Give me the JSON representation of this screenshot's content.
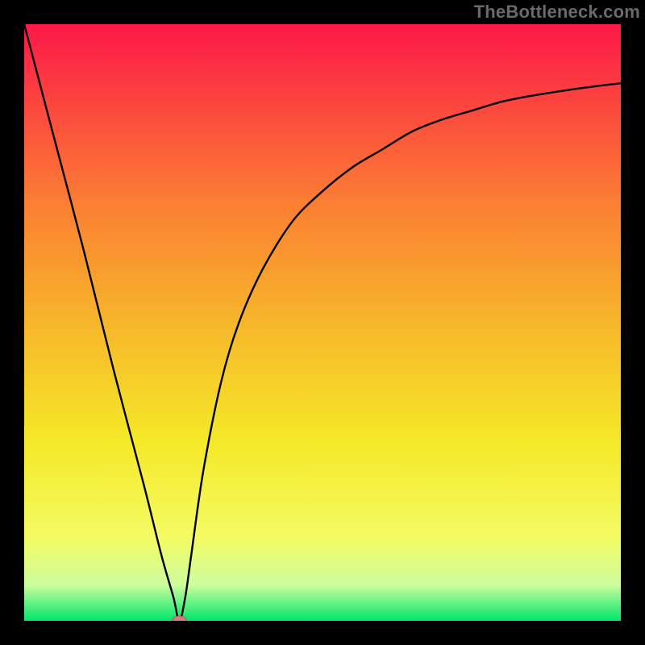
{
  "watermark": "TheBottleneck.com",
  "colors": {
    "frame": "#000000",
    "gradient_top": "#fd1848",
    "gradient_mid1": "#fb7e33",
    "gradient_mid2": "#f6b62a",
    "gradient_mid3": "#f5e928",
    "gradient_mid4": "#f4fb63",
    "gradient_mid5": "#cdfd9e",
    "gradient_bottom": "#00e66a",
    "curve": "#000000",
    "marker_fill": "#d47a80",
    "marker_stroke": "#bc5760"
  },
  "chart_data": {
    "type": "line",
    "title": "",
    "xlabel": "",
    "ylabel": "",
    "xlim": [
      0,
      100
    ],
    "ylim": [
      0,
      100
    ],
    "series": [
      {
        "name": "curve",
        "x": [
          0,
          5,
          10,
          15,
          20,
          23,
          25,
          26,
          27,
          28,
          30,
          33,
          36,
          40,
          45,
          50,
          55,
          60,
          65,
          70,
          75,
          80,
          85,
          90,
          95,
          100
        ],
        "y": [
          100,
          81,
          62,
          42,
          23,
          11,
          4,
          0,
          4,
          11,
          25,
          40,
          50,
          59,
          67,
          72,
          76,
          79,
          82,
          84,
          85.5,
          87,
          88,
          88.8,
          89.5,
          90.1
        ]
      }
    ],
    "marker": {
      "x": 26,
      "y": 0,
      "rx": 1.2,
      "ry": 0.8
    }
  }
}
